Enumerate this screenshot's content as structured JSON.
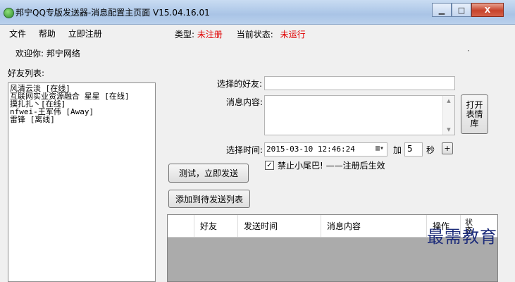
{
  "window": {
    "title": "邦宁QQ专版发送器-消息配置主页面 V15.04.16.01",
    "minimize": "▁",
    "maximize": "□",
    "close": "X"
  },
  "menu": [
    "文件",
    "帮助",
    "立即注册"
  ],
  "status": {
    "type_label": "类型:",
    "type_value": "未注册",
    "state_label": "当前状态:",
    "state_value": "未运行"
  },
  "welcome": "欢迎你:  邦宁网络",
  "dot": "·",
  "friends_label": "好友列表:",
  "friends": [
    "风清云淡 [在线]",
    "互联网实业资源融合 星星 [在线]",
    "摸扎扎丶[在线]",
    "nfwei-王军伟 [Away]",
    "雷锋 [离线]"
  ],
  "form": {
    "selected_label": "选择的好友:",
    "selected_value": "",
    "message_label": "消息内容:",
    "message_value": "",
    "time_label": "选择时间:",
    "time_value": "2015-03-10 12:46:24",
    "add_label": "加",
    "add_value": "5",
    "unit": "秒",
    "plus": "+",
    "checkbox_label": "禁止小尾巴! ——注册后生效",
    "checkbox_checked": true
  },
  "buttons": {
    "emoji": "打开表情库",
    "test_send": "测试，立即发送",
    "add_queue": "添加到待发送列表"
  },
  "table": {
    "columns": [
      "",
      "好友",
      "发送时间",
      "消息内容",
      "操作",
      "状态"
    ],
    "rows": []
  },
  "watermark": "最需教育"
}
